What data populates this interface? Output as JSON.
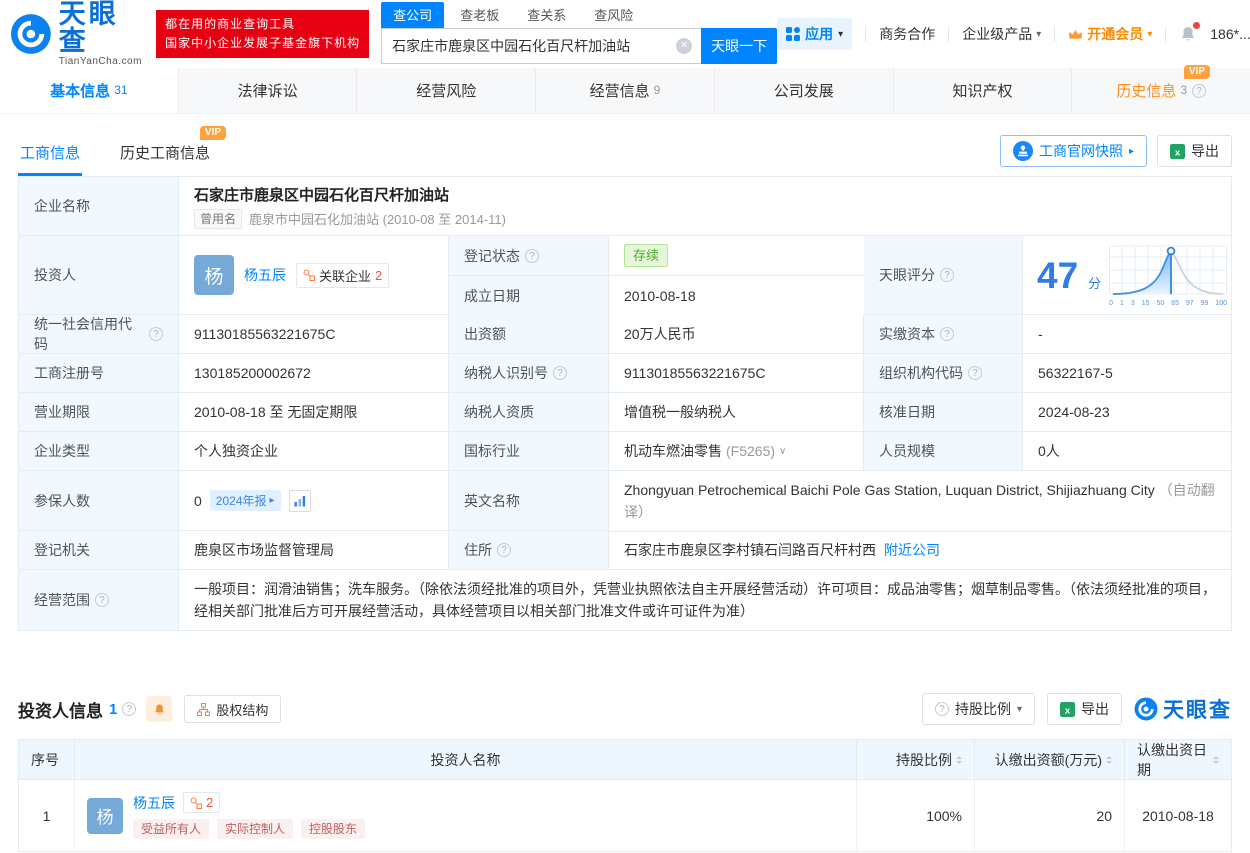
{
  "brand": {
    "blue": "#0084ff",
    "red": "#e60012",
    "orange": "#ff8a00",
    "green": "#49ad27",
    "avatar_blue": "#74a9d8"
  },
  "header": {
    "logo": {
      "title": "天眼查",
      "subtitle": "TianYanCha.com"
    },
    "promo": {
      "line1": "都在用的商业查询工具",
      "line2": "国家中小企业发展子基金旗下机构"
    },
    "search": {
      "tabs": [
        {
          "label": "查公司"
        },
        {
          "label": "查老板"
        },
        {
          "label": "查关系"
        },
        {
          "label": "查风险"
        }
      ],
      "value": "石家庄市鹿泉区中园石化百尺杆加油站",
      "button": "天眼一下"
    },
    "menu": {
      "apps": "应用",
      "biz": "商务合作",
      "enterprise": "企业级产品",
      "vip": "开通会员",
      "account": "186*..."
    }
  },
  "nav": {
    "tabs": [
      {
        "label": "基本信息",
        "count": "31"
      },
      {
        "label": "法律诉讼",
        "count": ""
      },
      {
        "label": "经营风险",
        "count": ""
      },
      {
        "label": "经营信息",
        "count": "9"
      },
      {
        "label": "公司发展",
        "count": ""
      },
      {
        "label": "知识产权",
        "count": ""
      },
      {
        "label": "历史信息",
        "count": "3"
      }
    ],
    "vip_badge": "VIP"
  },
  "subnav": {
    "tab1": "工商信息",
    "tab2": "历史工商信息",
    "vip_badge": "VIP",
    "snapshot_button": "工商官网快照",
    "export_button": "导出"
  },
  "company": {
    "name_label": "企业名称",
    "name": "石家庄市鹿泉区中园石化百尺杆加油站",
    "former_badge": "曾用名",
    "former": "鹿泉市中园石化加油站 (2010-08 至 2014-11)",
    "investor_label": "投资人",
    "avatar": "杨",
    "investor": "杨五辰",
    "related_label": "关联企业",
    "related_count": "2",
    "status_label": "登记状态",
    "status": "存续",
    "established_label": "成立日期",
    "established": "2010-08-18",
    "score_label": "天眼评分",
    "score": "47",
    "score_unit": "分",
    "score_ticks": [
      "0",
      "1",
      "3",
      "15",
      "50",
      "85",
      "97",
      "99",
      "100"
    ]
  },
  "rows": [
    {
      "l1": "统一社会信用代码",
      "v1": "91130185563221675C",
      "l2": "出资额",
      "v2": "20万人民币",
      "l3": "实缴资本",
      "v3": "-"
    },
    {
      "l1": "工商注册号",
      "v1": "130185200002672",
      "l2": "纳税人识别号",
      "v2": "91130185563221675C",
      "l3": "组织机构代码",
      "v3": "56322167-5"
    },
    {
      "l1": "营业期限",
      "v1": "2010-08-18 至 无固定期限",
      "l2": "纳税人资质",
      "v2": "增值税一般纳税人",
      "l3": "核准日期",
      "v3": "2024-08-23"
    },
    {
      "l1": "企业类型",
      "v1": "个人独资企业",
      "l2": "国标行业",
      "v2": "机动车燃油零售",
      "v2code": "(F5265)",
      "l3": "人员规模",
      "v3": "0人"
    }
  ],
  "extra": {
    "insured_label": "参保人数",
    "insured": "0",
    "report_badge": "2024年报",
    "english_label": "英文名称",
    "english": "Zhongyuan Petrochemical Baichi Pole Gas Station, Luquan District, Shijiazhuang City",
    "english_note": "（自动翻译）",
    "authority_label": "登记机关",
    "authority": "鹿泉区市场监督管理局",
    "address_label": "住所",
    "address": "石家庄市鹿泉区李村镇石闫路百尺杆村西",
    "nearby_link": "附近公司",
    "scope_label": "经营范围",
    "scope": "一般项目：润滑油销售；洗车服务。（除依法须经批准的项目外，凭营业执照依法自主开展经营活动）许可项目：成品油零售；烟草制品零售。（依法须经批准的项目，经相关部门批准后方可开展经营活动，具体经营项目以相关部门批准文件或许可证件为准）"
  },
  "investors": {
    "title": "投资人信息",
    "count": "1",
    "equity_button": "股权结构",
    "ratio_button": "持股比例",
    "export_button": "导出",
    "logo": "天眼查",
    "headers": {
      "index": "序号",
      "name": "投资人名称",
      "ratio": "持股比例",
      "amount": "认缴出资额(万元)",
      "date": "认缴出资日期"
    },
    "row": {
      "index": "1",
      "avatar": "杨",
      "name": "杨五辰",
      "badge_count": "2",
      "tags": [
        "受益所有人",
        "实际控制人",
        "控股股东"
      ],
      "ratio": "100%",
      "amount": "20",
      "date": "2010-08-18"
    }
  }
}
